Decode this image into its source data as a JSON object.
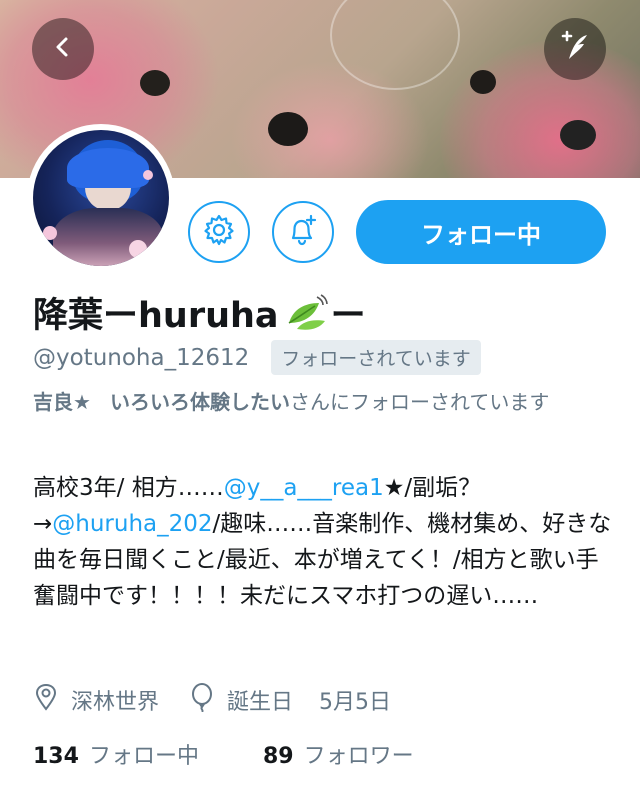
{
  "header": {
    "back_icon": "chevron-left-icon",
    "compose_icon": "quill-plus-icon"
  },
  "actions": {
    "settings_icon": "gear-icon",
    "notify_icon": "bell-plus-icon",
    "follow_label": "フォロー中",
    "accent_color": "#1da1f2"
  },
  "profile": {
    "display_name": "降葉ーhuruha",
    "name_suffix": "ー",
    "handle": "@yotunoha_12612",
    "follows_you": "フォローされています",
    "followed_by": {
      "user1": "吉良★",
      "user2": "いろいろ体験したい",
      "suffix": "さんにフォローされています"
    },
    "bio": {
      "p1": "高校3年/ 相方……",
      "m1": "@y__a___rea1",
      "p2": "★/副垢？→",
      "m2": "@huruha_202",
      "p3": "/趣味……音楽制作、機材集め、好きな曲を毎日聞くこと/最近、本が増えてく！/相方と歌い手奮闘中です！！！！未だにスマホ打つの遅い……"
    },
    "location": "深林世界",
    "birthday_label": "誕生日",
    "birthday_value": "5月5日",
    "following_count": "134",
    "following_label": "フォロー中",
    "followers_count": "89",
    "followers_label": "フォロワー"
  }
}
